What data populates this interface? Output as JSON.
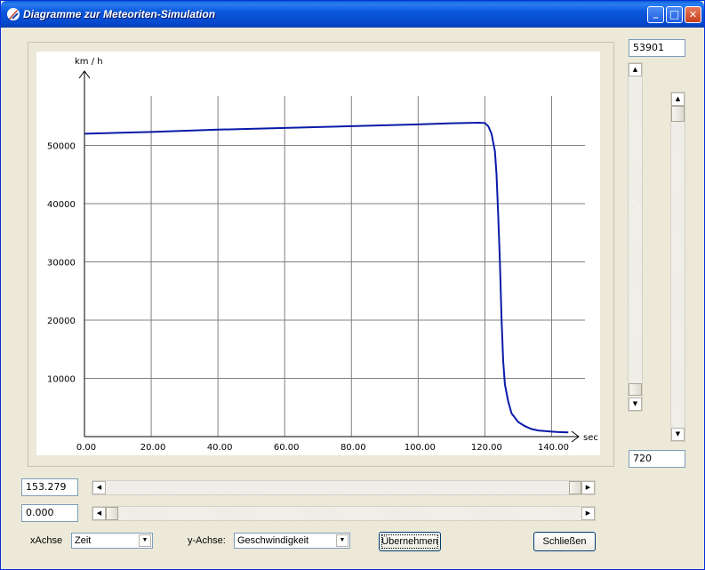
{
  "window": {
    "title": "Diagramme zur Meteoriten-Simulation",
    "min_glyph": "_",
    "max_glyph": "□",
    "close_glyph": "✕"
  },
  "inputs": {
    "y_max": "53901",
    "y_min": "720",
    "x_max": "153.279",
    "x_min": "0.000"
  },
  "controls": {
    "x_axis_label": "xAchse",
    "x_axis_value": "Zeit",
    "y_axis_label": "y-Achse:",
    "y_axis_value": "Geschwindigkeit",
    "apply_label": "Übernehmen",
    "close_label": "Schließen"
  },
  "scroll": {
    "arrow_up": "▲",
    "arrow_down": "▼",
    "arrow_left": "◀",
    "arrow_right": "▶",
    "combo_arrow": "▼"
  },
  "colors": {
    "line": "#0a1aa8",
    "grid": "#808080",
    "axis": "#000000"
  },
  "chart_data": {
    "type": "line",
    "xlabel": "sec",
    "ylabel": "km / h",
    "xlim": [
      0,
      150
    ],
    "ylim": [
      0,
      60000
    ],
    "x_ticks": [
      0,
      20,
      40,
      60,
      80,
      100,
      120,
      140
    ],
    "x_tick_labels": [
      "0.00",
      "20.00",
      "40.00",
      "60.00",
      "80.00",
      "100.00",
      "120.00",
      "140.00"
    ],
    "y_ticks": [
      10000,
      20000,
      30000,
      40000,
      50000
    ],
    "y_tick_labels": [
      "10000",
      "20000",
      "30000",
      "40000",
      "50000"
    ],
    "grid": true,
    "series": [
      {
        "x": [
          0,
          20,
          40,
          60,
          80,
          100,
          110,
          118,
          120,
          121,
          122,
          123,
          123.5,
          124,
          124.5,
          125,
          125.5,
          126,
          127,
          128,
          130,
          132,
          134,
          136,
          138,
          140,
          142,
          145
        ],
        "values": [
          52000,
          52300,
          52700,
          53000,
          53300,
          53600,
          53800,
          53900,
          53850,
          53300,
          52000,
          49000,
          45000,
          38000,
          30000,
          20000,
          13000,
          9000,
          6000,
          4000,
          2500,
          1800,
          1300,
          1050,
          950,
          850,
          780,
          720
        ]
      }
    ]
  }
}
